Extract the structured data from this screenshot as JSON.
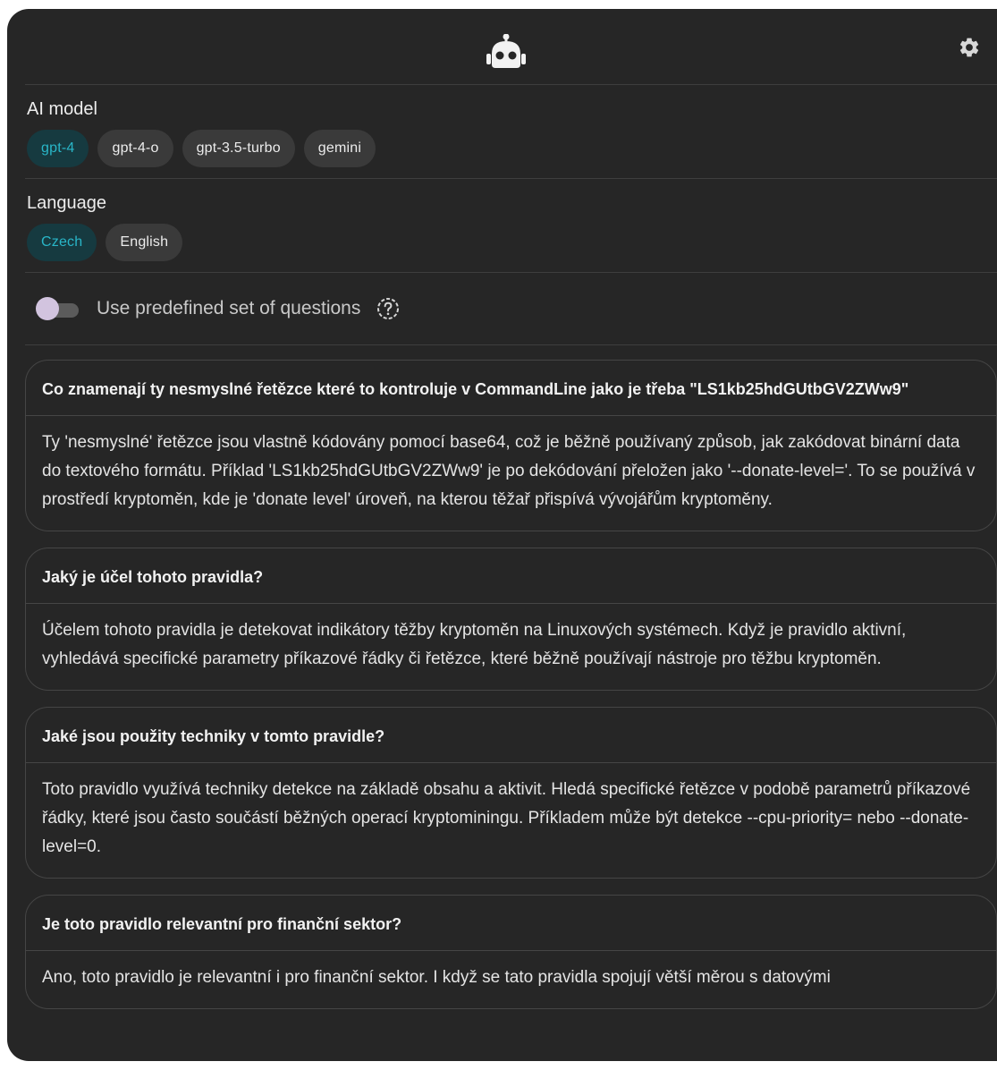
{
  "header": {
    "logo_icon": "robot-icon",
    "settings_icon": "gear-icon"
  },
  "model": {
    "label": "AI model",
    "options": [
      "gpt-4",
      "gpt-4-o",
      "gpt-3.5-turbo",
      "gemini"
    ],
    "selected": "gpt-4"
  },
  "language": {
    "label": "Language",
    "options": [
      "Czech",
      "English"
    ],
    "selected": "Czech"
  },
  "predefined": {
    "label": "Use predefined set of questions",
    "enabled": false,
    "help_icon": "question-circle-icon"
  },
  "colors": {
    "panel_bg": "#262626",
    "chip_bg": "#3a3a3a",
    "chip_active_bg": "#163a40",
    "chip_active_text": "#29b6c8",
    "toggle_thumb": "#d2c4df"
  },
  "qa": [
    {
      "question": "Co znamenají ty nesmyslné řetězce které to kontroluje v CommandLine jako je třeba \"LS1kb25hdGUtbGV2ZWw9\"",
      "answer": "Ty 'nesmyslné' řetězce jsou vlastně kódovány pomocí base64, což je běžně používaný způsob, jak zakódovat binární data do textového formátu. Příklad 'LS1kb25hdGUtbGV2ZWw9' je po dekódování přeložen jako '--donate-level='. To se používá v prostředí kryptoměn, kde je 'donate level' úroveň, na kterou těžař přispívá vývojářům kryptoměny."
    },
    {
      "question": "Jaký je účel tohoto pravidla?",
      "answer": "Účelem tohoto pravidla je detekovat indikátory těžby kryptoměn na Linuxových systémech. Když je pravidlo aktivní, vyhledává specifické parametry příkazové řádky či řetězce, které běžně používají nástroje pro těžbu kryptoměn."
    },
    {
      "question": "Jaké jsou použity techniky v tomto pravidle?",
      "answer": "Toto pravidlo využívá techniky detekce na základě obsahu a aktivit. Hledá specifické řetězce v podobě parametrů příkazové řádky, které jsou často součástí běžných operací kryptominingu. Příkladem může být detekce --cpu-priority= nebo --donate-level=0."
    },
    {
      "question": "Je toto pravidlo relevantní pro finanční sektor?",
      "answer": "Ano, toto pravidlo je relevantní i pro finanční sektor. I když se tato pravidla spojují větší měrou s datovými"
    }
  ]
}
